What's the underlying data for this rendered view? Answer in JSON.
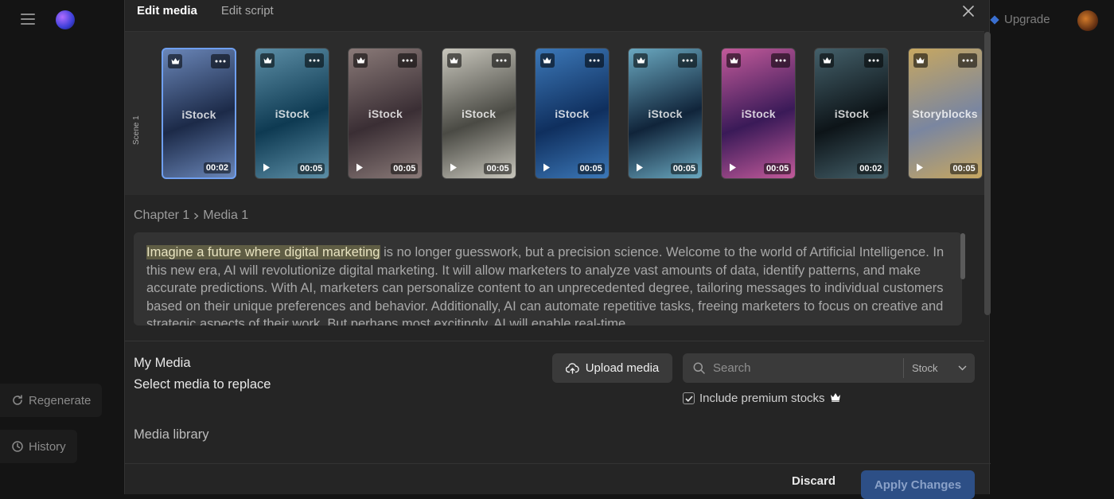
{
  "app": {
    "upgrade_label": "Upgrade",
    "sidebar": {
      "regenerate_label": "Regenerate",
      "history_label": "History"
    }
  },
  "modal": {
    "tabs": [
      {
        "label": "Edit media",
        "active": true
      },
      {
        "label": "Edit script",
        "active": false
      }
    ],
    "scene_label": "Scene 1",
    "thumbnails": [
      {
        "source": "iStock",
        "duration": "00:02",
        "selected": true,
        "play": false,
        "colors": [
          "#1c2a48",
          "#6a86b8"
        ]
      },
      {
        "source": "iStock",
        "duration": "00:05",
        "selected": false,
        "play": true,
        "colors": [
          "#0e3a52",
          "#5c8ea6"
        ]
      },
      {
        "source": "iStock",
        "duration": "00:05",
        "selected": false,
        "play": true,
        "colors": [
          "#3a2e34",
          "#8a7a78"
        ]
      },
      {
        "source": "iStock",
        "duration": "00:05",
        "selected": false,
        "play": true,
        "colors": [
          "#4a4a44",
          "#c8c6bc"
        ]
      },
      {
        "source": "iStock",
        "duration": "00:05",
        "selected": false,
        "play": true,
        "colors": [
          "#0f2f5e",
          "#3c78b8"
        ]
      },
      {
        "source": "iStock",
        "duration": "00:05",
        "selected": false,
        "play": true,
        "colors": [
          "#10243a",
          "#6aa8c0"
        ]
      },
      {
        "source": "iStock",
        "duration": "00:05",
        "selected": false,
        "play": true,
        "colors": [
          "#3a1a58",
          "#c25a9a"
        ]
      },
      {
        "source": "iStock",
        "duration": "00:02",
        "selected": false,
        "play": false,
        "colors": [
          "#0d1418",
          "#44606a"
        ]
      },
      {
        "source": "Storyblocks",
        "duration": "00:05",
        "selected": false,
        "play": true,
        "colors": [
          "#7a86a0",
          "#c7a760"
        ]
      }
    ],
    "breadcrumb": {
      "chapter": "Chapter 1",
      "media": "Media 1"
    },
    "script": {
      "highlight": "Imagine a future where digital marketing",
      "rest": " is no longer guesswork, but a precision science. Welcome to the world of Artificial Intelligence. In this new era, AI will revolutionize digital marketing. It will allow marketers to analyze vast amounts of data, identify patterns, and make accurate predictions. With AI, marketers can personalize content to an unprecedented degree, tailoring messages to individual customers based on their unique preferences and behavior. Additionally, AI can automate repetitive tasks, freeing marketers to focus on creative and strategic aspects of their work. But perhaps most excitingly, AI will enable real-time"
    },
    "my_media": {
      "title": "My Media",
      "subtitle": "Select media to replace",
      "library_title": "Media library",
      "upload_label": "Upload media",
      "search_placeholder": "Search",
      "source_select": "Stock",
      "premium_label": "Include premium stocks",
      "premium_checked": true
    },
    "footer": {
      "discard_label": "Discard",
      "apply_label": "Apply Changes"
    }
  }
}
